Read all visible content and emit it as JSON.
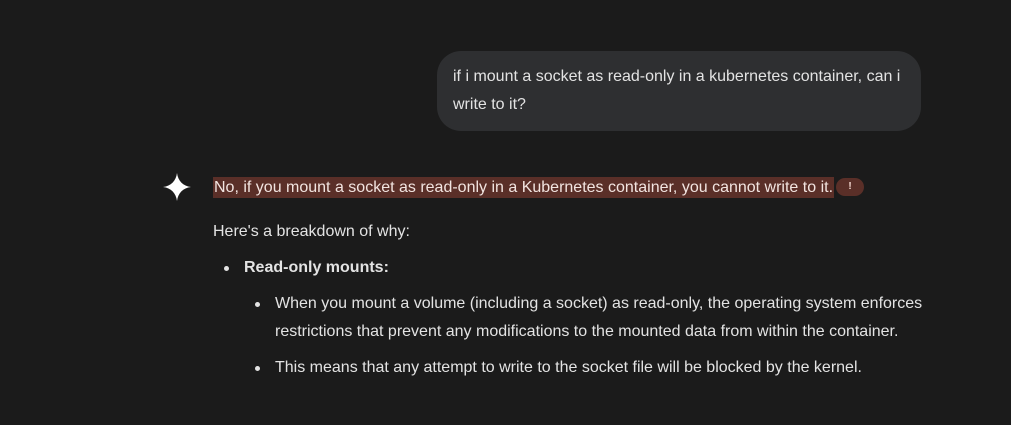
{
  "user_message": "if i mount a socket as read-only in a kubernetes container, can i write to it?",
  "assistant": {
    "icon": "gemini-spark-icon",
    "highlighted_statement": "No, if you mount a socket as read-only in a Kubernetes container, you cannot write to it.",
    "flag_glyph": "!",
    "intro": "Here's a breakdown of why:",
    "sections": [
      {
        "heading": "Read-only mounts:",
        "points": [
          "When you mount a volume (including a socket) as read-only, the operating system enforces restrictions that prevent any modifications to the mounted data from within the container.",
          "This means that any attempt to write to the socket file will be blocked by the kernel."
        ]
      }
    ]
  },
  "colors": {
    "background": "#1b1b1b",
    "user_bubble": "#2e2f31",
    "highlight": "#5a2f28",
    "text": "#e3e3e3"
  }
}
